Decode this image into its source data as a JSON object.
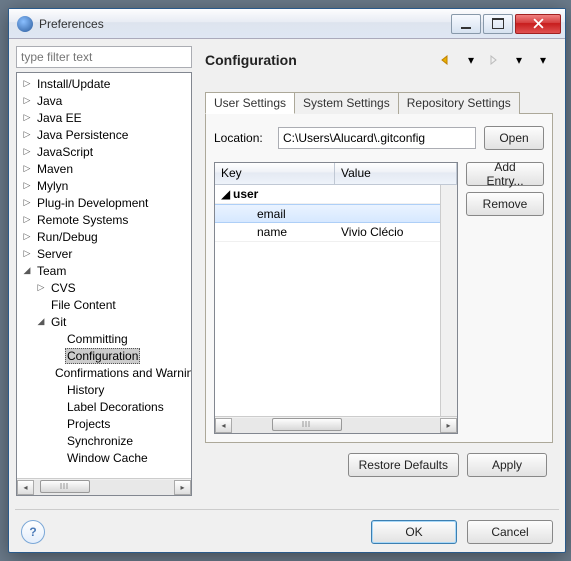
{
  "window": {
    "title": "Preferences"
  },
  "filter": {
    "placeholder": "type filter text"
  },
  "tree": [
    {
      "label": "Install/Update",
      "depth": 0,
      "tw": "▷"
    },
    {
      "label": "Java",
      "depth": 0,
      "tw": "▷"
    },
    {
      "label": "Java EE",
      "depth": 0,
      "tw": "▷"
    },
    {
      "label": "Java Persistence",
      "depth": 0,
      "tw": "▷"
    },
    {
      "label": "JavaScript",
      "depth": 0,
      "tw": "▷"
    },
    {
      "label": "Maven",
      "depth": 0,
      "tw": "▷"
    },
    {
      "label": "Mylyn",
      "depth": 0,
      "tw": "▷"
    },
    {
      "label": "Plug-in Development",
      "depth": 0,
      "tw": "▷"
    },
    {
      "label": "Remote Systems",
      "depth": 0,
      "tw": "▷"
    },
    {
      "label": "Run/Debug",
      "depth": 0,
      "tw": "▷"
    },
    {
      "label": "Server",
      "depth": 0,
      "tw": "▷"
    },
    {
      "label": "Team",
      "depth": 0,
      "tw": "◢"
    },
    {
      "label": "CVS",
      "depth": 1,
      "tw": "▷"
    },
    {
      "label": "File Content",
      "depth": 1,
      "tw": ""
    },
    {
      "label": "Git",
      "depth": 1,
      "tw": "◢"
    },
    {
      "label": "Committing",
      "depth": 2,
      "tw": ""
    },
    {
      "label": "Configuration",
      "depth": 2,
      "tw": "",
      "selected": true
    },
    {
      "label": "Confirmations and Warnings",
      "depth": 2,
      "tw": ""
    },
    {
      "label": "History",
      "depth": 2,
      "tw": ""
    },
    {
      "label": "Label Decorations",
      "depth": 2,
      "tw": ""
    },
    {
      "label": "Projects",
      "depth": 2,
      "tw": ""
    },
    {
      "label": "Synchronize",
      "depth": 2,
      "tw": ""
    },
    {
      "label": "Window Cache",
      "depth": 2,
      "tw": ""
    }
  ],
  "page": {
    "title": "Configuration",
    "tabs": [
      "User Settings",
      "System Settings",
      "Repository Settings"
    ],
    "active_tab": 0,
    "location_label": "Location:",
    "location_value": "C:\\Users\\Alucard\\.gitconfig",
    "open_btn": "Open",
    "table": {
      "headers": {
        "key": "Key",
        "value": "Value"
      },
      "rows": [
        {
          "key": "user",
          "value": "",
          "group": true,
          "depth": 0
        },
        {
          "key": "email",
          "value": "",
          "depth": 1,
          "selected": true
        },
        {
          "key": "name",
          "value": "Vivio Clécio",
          "depth": 1
        }
      ]
    },
    "add_entry_btn": "Add Entry...",
    "remove_btn": "Remove",
    "restore_btn": "Restore Defaults",
    "apply_btn": "Apply"
  },
  "footer": {
    "ok": "OK",
    "cancel": "Cancel"
  }
}
